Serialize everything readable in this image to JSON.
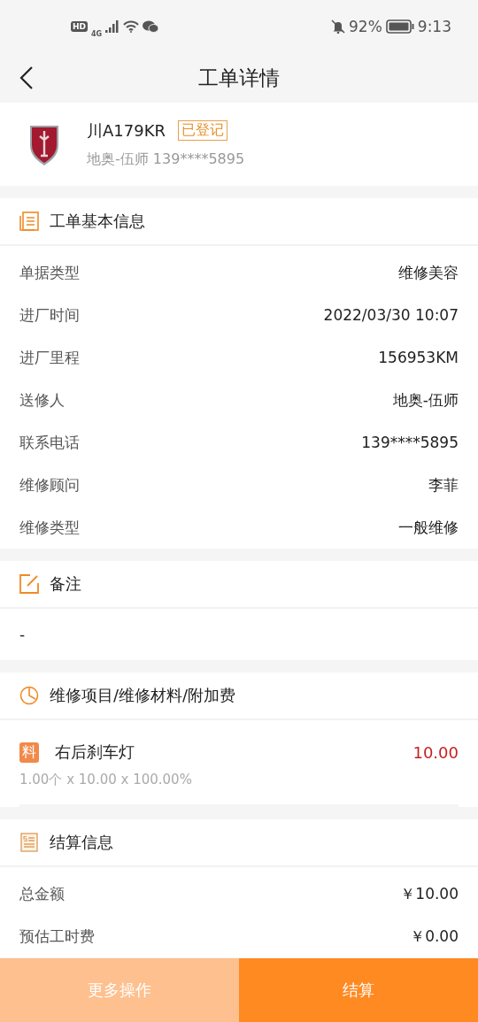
{
  "status_bar": {
    "hd": "HD",
    "network": "4G",
    "battery": "92%",
    "time": "9:13"
  },
  "nav": {
    "title": "工单详情"
  },
  "vehicle": {
    "plate": "川A179KR",
    "status": "已登记",
    "owner": "地奥-伍师 139****5895"
  },
  "sections": [
    {
      "kind": "fields",
      "title": "工单基本信息",
      "rows": [
        {
          "label": "单据类型",
          "value": "维修美容"
        },
        {
          "label": "进厂时间",
          "value": "2022/03/30 10:07"
        },
        {
          "label": "进厂里程",
          "value": "156953KM"
        },
        {
          "label": "送修人",
          "value": "地奥-伍师"
        },
        {
          "label": "联系电话",
          "value": "139****5895"
        },
        {
          "label": "维修顾问",
          "value": "李菲"
        },
        {
          "label": "维修类型",
          "value": "一般维修"
        }
      ]
    },
    {
      "kind": "text",
      "title": "备注",
      "text": "-"
    },
    {
      "kind": "items",
      "title": "维修项目/维修材料/附加费",
      "items": [
        {
          "tag": "料",
          "name": "右后刹车灯",
          "price": "10.00",
          "detail": "1.00个 x 10.00 x 100.00%"
        }
      ]
    },
    {
      "kind": "fields",
      "title": "结算信息",
      "rows": [
        {
          "label": "总金额",
          "value": "￥10.00"
        },
        {
          "label": "预估工时费",
          "value": "￥0.00"
        }
      ]
    }
  ],
  "actions": [
    {
      "label": "更多操作",
      "primary": false
    },
    {
      "label": "结算",
      "primary": true
    }
  ]
}
